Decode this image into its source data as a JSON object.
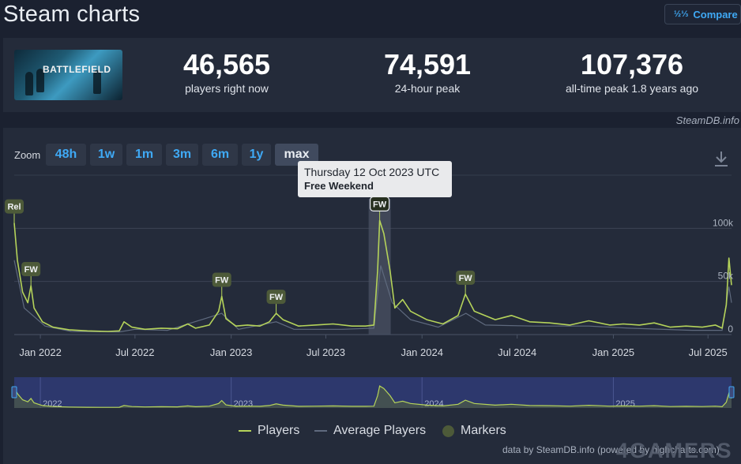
{
  "header": {
    "title": "Steam charts",
    "compare_label": "Compare",
    "compare_icon": "fraction-icon"
  },
  "game": {
    "thumb_logo": "BATTLEFIELD"
  },
  "stats": [
    {
      "value": "46,565",
      "label": "players right now"
    },
    {
      "value": "74,591",
      "label": "24-hour peak"
    },
    {
      "value": "107,376",
      "label": "all-time peak 1.8 years ago"
    }
  ],
  "credit_top": "SteamDB.info",
  "zoom": {
    "label": "Zoom",
    "options": [
      "48h",
      "1w",
      "1m",
      "3m",
      "6m",
      "1y",
      "max"
    ],
    "active": "max"
  },
  "tooltip": {
    "date": "Thursday 12 Oct 2023 UTC",
    "event": "Free Weekend"
  },
  "legend": [
    "Players",
    "Average Players",
    "Markers"
  ],
  "credit_bottom": "data by SteamDB.info (powered by highcharts.com)",
  "watermark": "4GAMERS",
  "colors": {
    "players": "#b5d35a",
    "average": "#5f6a7e",
    "marker": "#4d5a39",
    "accent": "#3fa9f5"
  },
  "chart_data": {
    "type": "line",
    "title": "",
    "xlabel": "",
    "ylabel": "",
    "x_ticks": [
      "Jan 2022",
      "Jul 2022",
      "Jan 2023",
      "Jul 2023",
      "Jan 2024",
      "Jul 2024",
      "Jan 2025",
      "Jul 2025"
    ],
    "navigator_ticks": [
      "2022",
      "2023",
      "2024",
      "2025"
    ],
    "y_ticks": [
      {
        "value": 0,
        "label": "0"
      },
      {
        "value": 50000,
        "label": "50k"
      },
      {
        "value": 100000,
        "label": "100k"
      }
    ],
    "ylim": [
      0,
      150000
    ],
    "xlim": [
      "2021-11-12",
      "2025-08-15"
    ],
    "series": [
      {
        "name": "Players",
        "points": [
          [
            "2021-11-12",
            105000
          ],
          [
            "2021-11-18",
            70000
          ],
          [
            "2021-11-28",
            40000
          ],
          [
            "2021-12-08",
            30000
          ],
          [
            "2021-12-14",
            46000
          ],
          [
            "2021-12-20",
            25000
          ],
          [
            "2022-01-05",
            12000
          ],
          [
            "2022-01-25",
            7000
          ],
          [
            "2022-02-25",
            4500
          ],
          [
            "2022-04-01",
            3500
          ],
          [
            "2022-05-10",
            3000
          ],
          [
            "2022-06-01",
            3500
          ],
          [
            "2022-06-10",
            12000
          ],
          [
            "2022-06-25",
            7000
          ],
          [
            "2022-07-20",
            5000
          ],
          [
            "2022-08-20",
            6000
          ],
          [
            "2022-09-20",
            5500
          ],
          [
            "2022-10-10",
            10000
          ],
          [
            "2022-10-25",
            6000
          ],
          [
            "2022-11-20",
            9000
          ],
          [
            "2022-12-08",
            22000
          ],
          [
            "2022-12-14",
            36000
          ],
          [
            "2022-12-22",
            15000
          ],
          [
            "2023-01-10",
            8000
          ],
          [
            "2023-02-01",
            9000
          ],
          [
            "2023-02-25",
            8000
          ],
          [
            "2023-03-15",
            12000
          ],
          [
            "2023-03-28",
            20000
          ],
          [
            "2023-04-10",
            14000
          ],
          [
            "2023-05-10",
            8000
          ],
          [
            "2023-06-10",
            9000
          ],
          [
            "2023-07-15",
            10000
          ],
          [
            "2023-08-20",
            8000
          ],
          [
            "2023-09-15",
            8000
          ],
          [
            "2023-10-01",
            9000
          ],
          [
            "2023-10-08",
            60000
          ],
          [
            "2023-10-12",
            107376
          ],
          [
            "2023-10-20",
            95000
          ],
          [
            "2023-11-01",
            60000
          ],
          [
            "2023-11-10",
            25000
          ],
          [
            "2023-11-25",
            33000
          ],
          [
            "2023-12-10",
            22000
          ],
          [
            "2024-01-10",
            14000
          ],
          [
            "2024-02-10",
            10000
          ],
          [
            "2024-03-10",
            18000
          ],
          [
            "2024-03-24",
            38000
          ],
          [
            "2024-04-10",
            22000
          ],
          [
            "2024-05-20",
            14000
          ],
          [
            "2024-06-20",
            18000
          ],
          [
            "2024-07-25",
            12000
          ],
          [
            "2024-09-01",
            11000
          ],
          [
            "2024-10-10",
            9000
          ],
          [
            "2024-11-15",
            13000
          ],
          [
            "2024-12-25",
            9000
          ],
          [
            "2025-01-20",
            10000
          ],
          [
            "2025-02-20",
            9000
          ],
          [
            "2025-03-20",
            11000
          ],
          [
            "2025-04-20",
            7000
          ],
          [
            "2025-05-20",
            8000
          ],
          [
            "2025-06-20",
            7000
          ],
          [
            "2025-07-15",
            9000
          ],
          [
            "2025-07-28",
            6000
          ],
          [
            "2025-08-05",
            28000
          ],
          [
            "2025-08-10",
            72000
          ],
          [
            "2025-08-15",
            46565
          ]
        ]
      },
      {
        "name": "Average Players",
        "points": [
          [
            "2021-11-12",
            70000
          ],
          [
            "2021-12-01",
            25000
          ],
          [
            "2022-01-10",
            8000
          ],
          [
            "2022-03-01",
            3000
          ],
          [
            "2022-06-01",
            2500
          ],
          [
            "2022-07-01",
            5000
          ],
          [
            "2022-09-01",
            4000
          ],
          [
            "2022-12-14",
            20000
          ],
          [
            "2023-01-15",
            5000
          ],
          [
            "2023-03-28",
            12000
          ],
          [
            "2023-05-01",
            5000
          ],
          [
            "2023-08-01",
            5000
          ],
          [
            "2023-10-01",
            6000
          ],
          [
            "2023-10-14",
            65000
          ],
          [
            "2023-11-05",
            30000
          ],
          [
            "2023-12-10",
            14000
          ],
          [
            "2024-02-01",
            7000
          ],
          [
            "2024-03-25",
            20000
          ],
          [
            "2024-05-01",
            9000
          ],
          [
            "2024-08-01",
            8000
          ],
          [
            "2024-11-15",
            8000
          ],
          [
            "2025-02-01",
            6000
          ],
          [
            "2025-06-01",
            4000
          ],
          [
            "2025-07-28",
            4000
          ],
          [
            "2025-08-10",
            45000
          ],
          [
            "2025-08-15",
            30000
          ]
        ]
      }
    ],
    "markers": [
      {
        "label": "Rel",
        "x": "2021-11-12"
      },
      {
        "label": "FW",
        "x": "2021-12-14"
      },
      {
        "label": "FW",
        "x": "2022-12-14"
      },
      {
        "label": "FW",
        "x": "2023-03-28"
      },
      {
        "label": "FW",
        "x": "2023-10-12"
      },
      {
        "label": "FW",
        "x": "2024-03-24"
      }
    ],
    "highlight": "2023-10-12",
    "grid": true,
    "legend_position": "bottom-center"
  }
}
